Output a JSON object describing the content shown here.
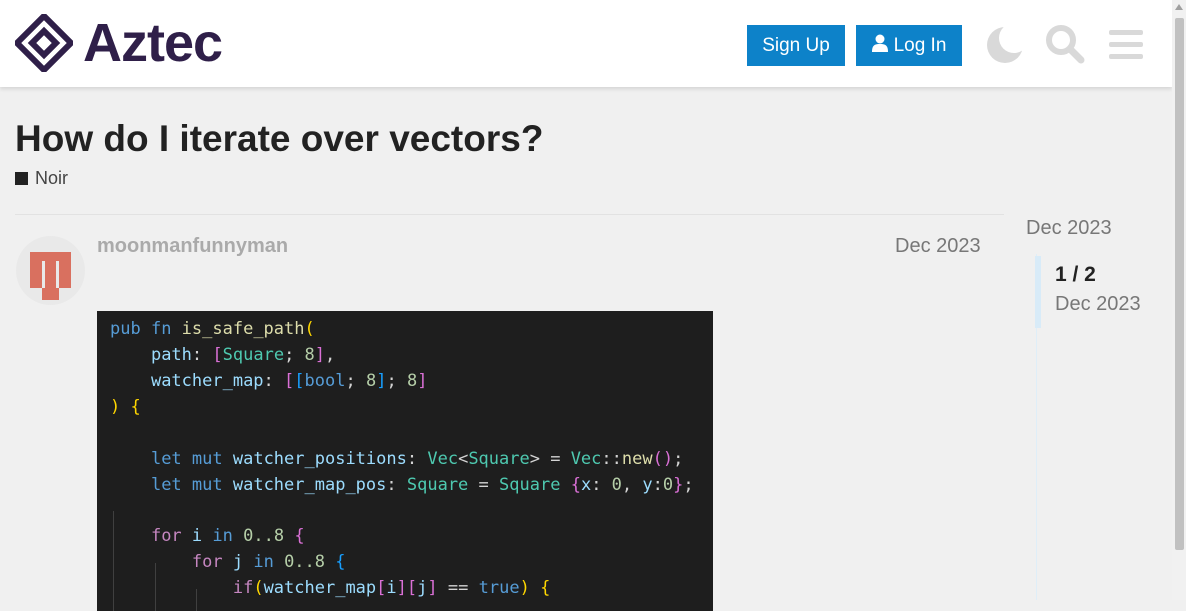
{
  "header": {
    "logo_text": "Aztec",
    "signup_label": "Sign Up",
    "login_label": "Log In",
    "icons": [
      "moon-icon",
      "search-icon",
      "menu-icon",
      "user-icon"
    ],
    "accent_color": "#0d82c9",
    "brand_color": "#2f1f49"
  },
  "topic": {
    "title": "How do I iterate over vectors?",
    "category": "Noir"
  },
  "post": {
    "username": "moonmanfunnyman",
    "date": "Dec 2023",
    "code_lines": [
      [
        {
          "t": "pub ",
          "c": "kw"
        },
        {
          "t": "fn ",
          "c": "kw"
        },
        {
          "t": "is_safe_path",
          "c": "fn"
        },
        {
          "t": "(",
          "c": "p1"
        }
      ],
      [
        {
          "t": "    "
        },
        {
          "t": "path",
          "c": "var"
        },
        {
          "t": ": "
        },
        {
          "t": "[",
          "c": "p2"
        },
        {
          "t": "Square",
          "c": "ty"
        },
        {
          "t": "; "
        },
        {
          "t": "8",
          "c": "num"
        },
        {
          "t": "]",
          "c": "p2"
        },
        {
          "t": ","
        }
      ],
      [
        {
          "t": "    "
        },
        {
          "t": "watcher_map",
          "c": "var"
        },
        {
          "t": ": "
        },
        {
          "t": "[",
          "c": "p2"
        },
        {
          "t": "[",
          "c": "p3"
        },
        {
          "t": "bool",
          "c": "kw"
        },
        {
          "t": "; "
        },
        {
          "t": "8",
          "c": "num"
        },
        {
          "t": "]",
          "c": "p3"
        },
        {
          "t": "; "
        },
        {
          "t": "8",
          "c": "num"
        },
        {
          "t": "]",
          "c": "p2"
        }
      ],
      [
        {
          "t": ")",
          "c": "p1"
        },
        {
          "t": " "
        },
        {
          "t": "{",
          "c": "p1"
        }
      ],
      [
        {
          "t": ""
        }
      ],
      [
        {
          "t": "    "
        },
        {
          "t": "let ",
          "c": "kw"
        },
        {
          "t": "mut ",
          "c": "kw"
        },
        {
          "t": "watcher_positions",
          "c": "var"
        },
        {
          "t": ": "
        },
        {
          "t": "Vec",
          "c": "ty"
        },
        {
          "t": "<"
        },
        {
          "t": "Square",
          "c": "ty"
        },
        {
          "t": "> = "
        },
        {
          "t": "Vec",
          "c": "ty"
        },
        {
          "t": "::"
        },
        {
          "t": "new",
          "c": "fn"
        },
        {
          "t": "(",
          "c": "p2"
        },
        {
          "t": ")",
          "c": "p2"
        },
        {
          "t": ";"
        }
      ],
      [
        {
          "t": "    "
        },
        {
          "t": "let ",
          "c": "kw"
        },
        {
          "t": "mut ",
          "c": "kw"
        },
        {
          "t": "watcher_map_pos",
          "c": "var"
        },
        {
          "t": ": "
        },
        {
          "t": "Square",
          "c": "ty"
        },
        {
          "t": " = "
        },
        {
          "t": "Square",
          "c": "ty"
        },
        {
          "t": " "
        },
        {
          "t": "{",
          "c": "p2"
        },
        {
          "t": "x",
          "c": "var"
        },
        {
          "t": ": "
        },
        {
          "t": "0",
          "c": "num"
        },
        {
          "t": ", "
        },
        {
          "t": "y",
          "c": "var"
        },
        {
          "t": ":"
        },
        {
          "t": "0",
          "c": "num"
        },
        {
          "t": "}",
          "c": "p2"
        },
        {
          "t": ";"
        }
      ],
      [
        {
          "t": ""
        }
      ],
      [
        {
          "t": "    "
        },
        {
          "t": "for ",
          "c": "ctl"
        },
        {
          "t": "i",
          "c": "var"
        },
        {
          "t": " "
        },
        {
          "t": "in ",
          "c": "kw"
        },
        {
          "t": "0..8",
          "c": "num"
        },
        {
          "t": " "
        },
        {
          "t": "{",
          "c": "p2"
        }
      ],
      [
        {
          "t": "        "
        },
        {
          "t": "for ",
          "c": "ctl"
        },
        {
          "t": "j",
          "c": "var"
        },
        {
          "t": " "
        },
        {
          "t": "in ",
          "c": "kw"
        },
        {
          "t": "0..8",
          "c": "num"
        },
        {
          "t": " "
        },
        {
          "t": "{",
          "c": "p3"
        }
      ],
      [
        {
          "t": "            "
        },
        {
          "t": "if",
          "c": "ctl"
        },
        {
          "t": "(",
          "c": "p1"
        },
        {
          "t": "watcher_map",
          "c": "var"
        },
        {
          "t": "[",
          "c": "p2"
        },
        {
          "t": "i",
          "c": "var"
        },
        {
          "t": "]",
          "c": "p2"
        },
        {
          "t": "[",
          "c": "p2"
        },
        {
          "t": "j",
          "c": "var"
        },
        {
          "t": "]",
          "c": "p2"
        },
        {
          "t": " == "
        },
        {
          "t": "true",
          "c": "kw"
        },
        {
          "t": ")",
          "c": "p1"
        },
        {
          "t": " "
        },
        {
          "t": "{",
          "c": "p1"
        }
      ]
    ]
  },
  "timeline": {
    "top_date": "Dec 2023",
    "position": "1 / 2",
    "current_date": "Dec 2023"
  }
}
